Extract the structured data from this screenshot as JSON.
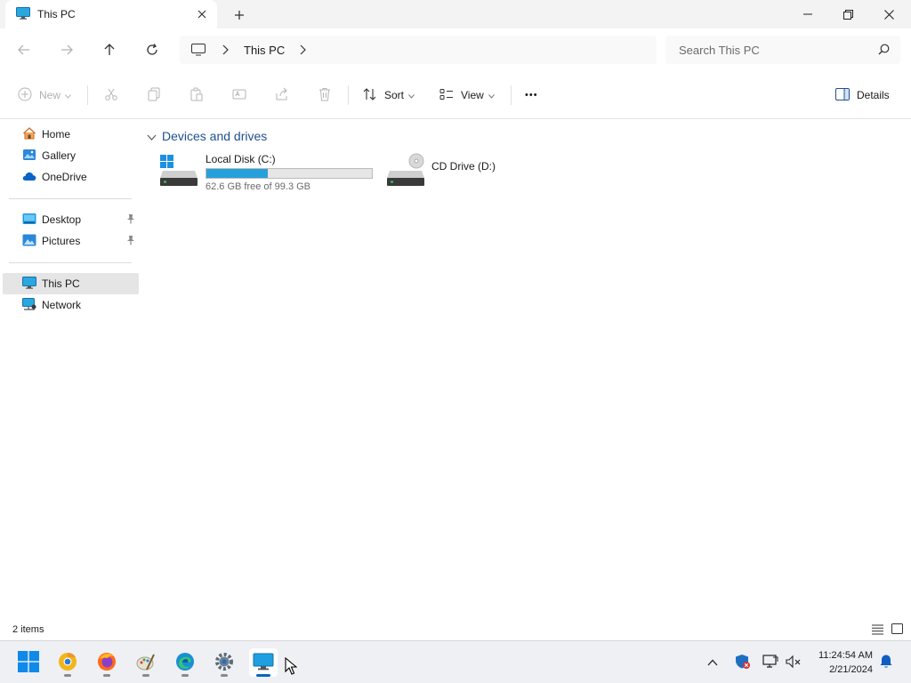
{
  "window": {
    "tab_title": "This PC",
    "new_tab": "+"
  },
  "address": {
    "crumbs": [
      "This PC"
    ],
    "search_placeholder": "Search This PC"
  },
  "commands": {
    "new": "New",
    "sort": "Sort",
    "view": "View",
    "more": "•••",
    "details": "Details"
  },
  "sidebar": {
    "items": [
      {
        "label": "Home",
        "icon": "home-icon"
      },
      {
        "label": "Gallery",
        "icon": "gallery-icon"
      },
      {
        "label": "OneDrive",
        "icon": "onedrive-icon"
      },
      {
        "label": "Desktop",
        "icon": "desktop-folder-icon",
        "pinned": true
      },
      {
        "label": "Pictures",
        "icon": "pictures-folder-icon",
        "pinned": true
      },
      {
        "label": "This PC",
        "icon": "this-pc-icon",
        "selected": true
      },
      {
        "label": "Network",
        "icon": "network-icon"
      }
    ]
  },
  "content": {
    "group_title": "Devices and drives",
    "drives": [
      {
        "name": "Local Disk (C:)",
        "free_text": "62.6 GB free of 99.3 GB",
        "used_fraction": 0.37,
        "icon": "windows-drive-icon"
      },
      {
        "name": "CD Drive (D:)",
        "icon": "cd-drive-icon"
      }
    ]
  },
  "status": {
    "item_count": "2 items"
  },
  "taskbar": {
    "apps": [
      "start-icon",
      "chrome-canary-icon",
      "firefox-icon",
      "paint-icon",
      "edge-icon",
      "settings-icon",
      "file-explorer-icon"
    ],
    "time": "11:24:54 AM",
    "date": "2/21/2024"
  },
  "colors": {
    "accent": "#0067c0",
    "drive_fill": "#26a0da",
    "group_header": "#1f4f8f"
  }
}
